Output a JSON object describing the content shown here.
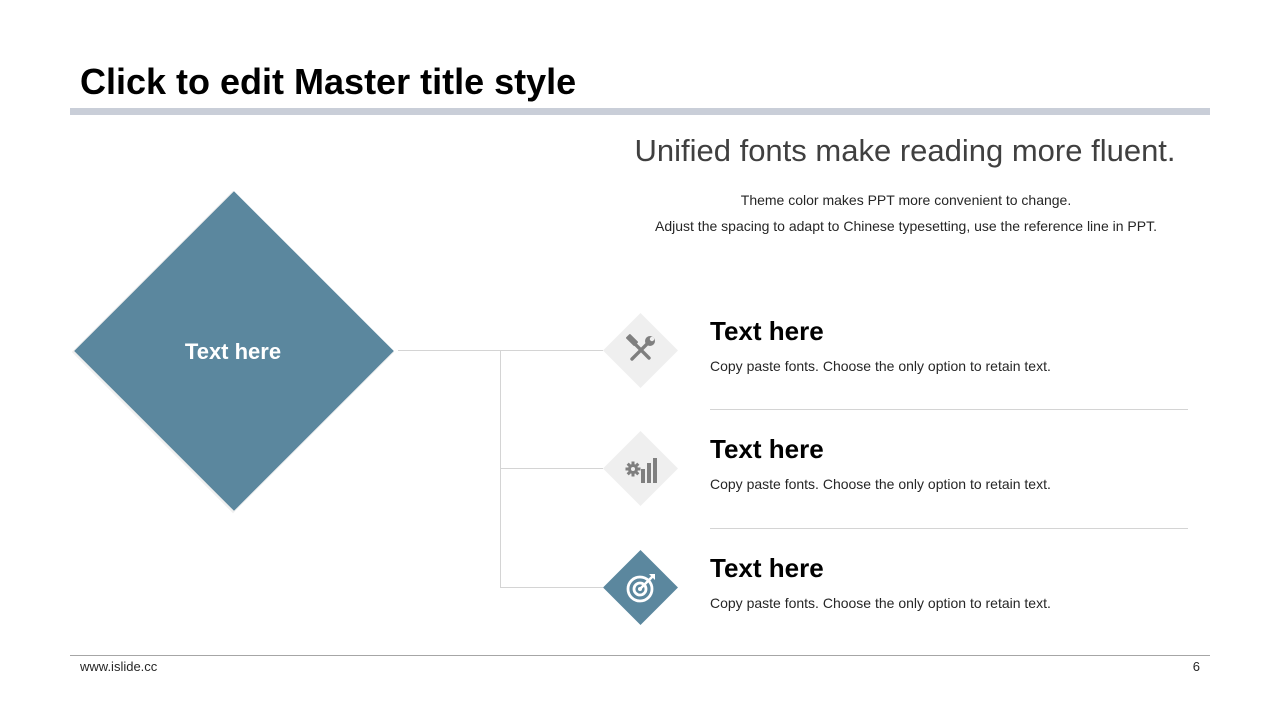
{
  "slide": {
    "title": "Click to edit Master title style",
    "subtitle": "Unified fonts make reading more fluent.",
    "description_lines": [
      "Theme color makes PPT more convenient to change.",
      "Adjust the spacing to adapt to Chinese typesetting, use the reference line in PPT."
    ],
    "main_diamond_label": "Text here",
    "items": [
      {
        "title": "Text here",
        "text": "Copy paste fonts. Choose the only option to retain text.",
        "icon": "tools-icon"
      },
      {
        "title": "Text here",
        "text": "Copy paste fonts. Choose the only option to retain text.",
        "icon": "gear-chart-icon"
      },
      {
        "title": "Text here",
        "text": "Copy paste fonts. Choose the only option to retain text.",
        "icon": "target-icon"
      }
    ]
  },
  "footer": {
    "url": "www.islide.cc",
    "page_number": "6"
  },
  "colors": {
    "accent": "#5b879e",
    "light_shape": "#efefef",
    "title_rule": "#c9ced8",
    "connector": "#d4d4d4"
  }
}
